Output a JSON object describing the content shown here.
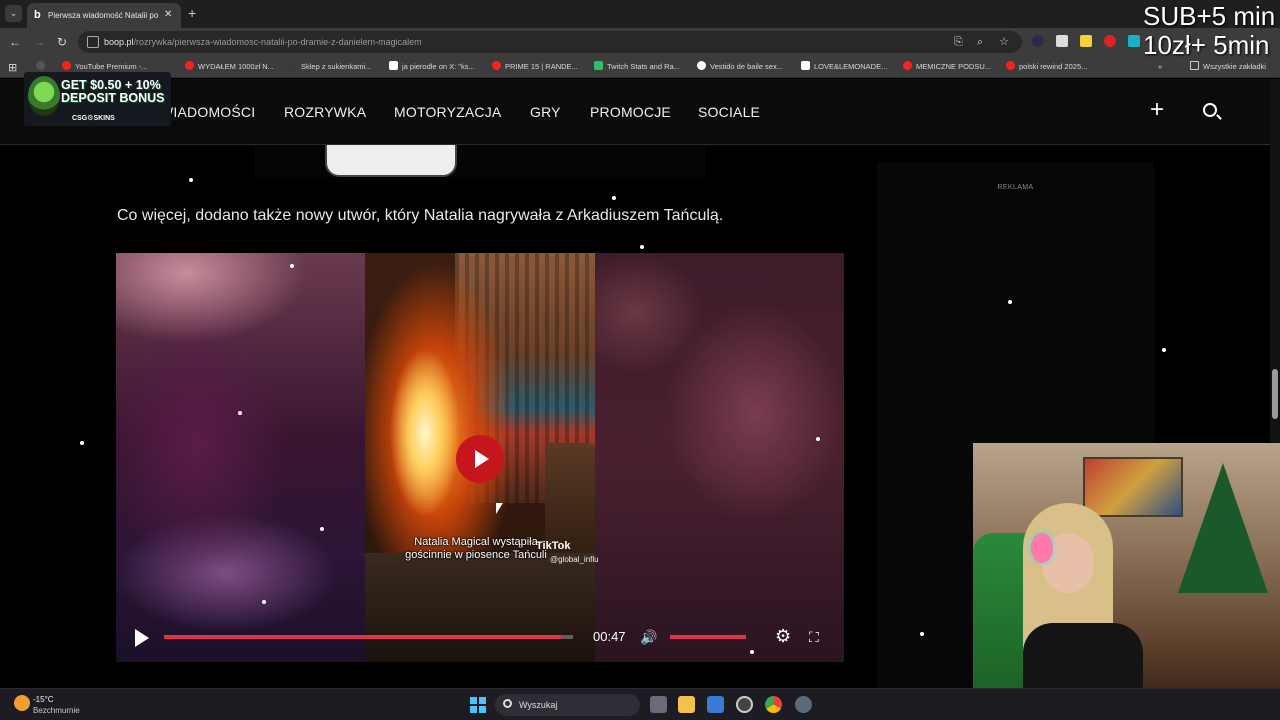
{
  "browser": {
    "tab_title": "Pierwsza wiadomość Natalii po dramie z danielem magicalem",
    "tab_favicon": "b",
    "close_glyph": "✕",
    "new_tab_glyph": "+",
    "url_host": "boop.pl",
    "url_path": "/rozrywka/pierwsza-wiadomosc-natalii-po-dramie-z-danielem-magicalem",
    "bookmarks": [
      {
        "label": "YouTube Premium -...",
        "color": "#ff2020"
      },
      {
        "label": "WYDAŁEM 1000zł N...",
        "color": "#ff2020"
      },
      {
        "label": "Sklep z sukienkami...",
        "color": "#3a3a3a"
      },
      {
        "label": "ja pierodle on X: \"ks...",
        "color": "#ffffff"
      },
      {
        "label": "PRIME 15 | RANDE...",
        "color": "#ff2020"
      },
      {
        "label": "Twitch Stats and Ra...",
        "color": "#2fbf71"
      },
      {
        "label": "Vestido de baile sex...",
        "color": "#ffffff"
      },
      {
        "label": "LOVE&LEMONADE...",
        "color": "#ffffff"
      },
      {
        "label": "MEMICZNE PODSU...",
        "color": "#ff2020"
      },
      {
        "label": "polski rewind 2025...",
        "color": "#ff2020"
      }
    ],
    "all_bookmarks": "Wszystkie zakładki"
  },
  "promo": {
    "text": "GET $0.50 + 10% DEPOSIT BONUS",
    "brand": "CSG⚙SKINS"
  },
  "site_nav": {
    "items": [
      "WIADOMOŚCI",
      "ROZRYWKA",
      "MOTORYZACJA",
      "GRY",
      "PROMOCJE",
      "SOCIALE"
    ],
    "plus_glyph": "+"
  },
  "article": {
    "paragraph": "Co więcej, dodano także nowy utwór, który Natalia nagrywała z Arkadiuszem Tańculą."
  },
  "video": {
    "caption": "Natalia Magical wystąpiła gościnnie w piosence Tańculi",
    "tiktok_label": "TikTok",
    "tiktok_user": "@global_influ",
    "time": "00:47",
    "progress": 0.97,
    "volume": 1.0,
    "volume_glyph": "🔊",
    "settings_glyph": "⚙",
    "fullscreen_glyph": "⛶"
  },
  "sidebar": {
    "ad_label": "REKLAMA"
  },
  "overlay": {
    "line1": "SUB+5 min",
    "line2": "10zł+ 5min"
  },
  "taskbar": {
    "temperature": "-15°C",
    "weather": "Bezchmurnie",
    "search_placeholder": "Wyszukaj"
  },
  "colors": {
    "accent_red": "#e0334a",
    "play_red": "#c4161c"
  }
}
